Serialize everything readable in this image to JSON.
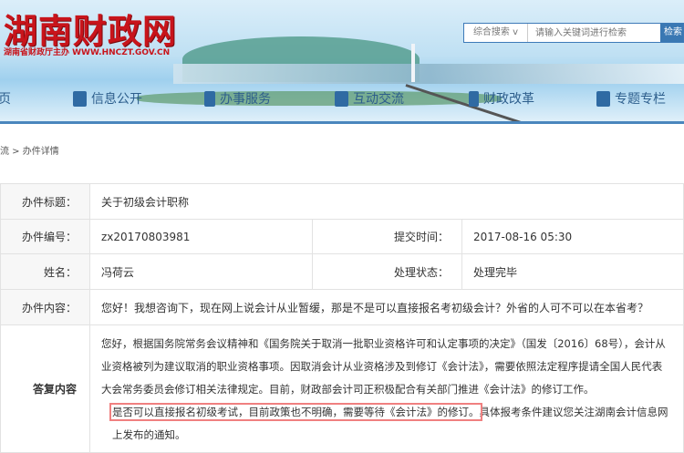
{
  "site": {
    "logo": "湖南财政网",
    "subtitle": "湖南省财政厅主办 WWW.HNCZT.GOV.CN"
  },
  "search": {
    "scope": "综合搜索 v",
    "placeholder": "请输入关键词进行检索",
    "button": "检索"
  },
  "nav": [
    {
      "label": "页"
    },
    {
      "label": "信息公开"
    },
    {
      "label": "办事服务"
    },
    {
      "label": "互动交流"
    },
    {
      "label": "财政改革"
    },
    {
      "label": "专题专栏"
    }
  ],
  "breadcrumb": "流 > 办件详情",
  "detail": {
    "title_label": "办件标题：",
    "title": "关于初级会计职称",
    "id_label": "办件编号：",
    "id": "zx20170803981",
    "time_label": "提交时间：",
    "time": "2017-08-16 05:30",
    "name_label": "姓名：",
    "name": "冯荷云",
    "status_label": "处理状态：",
    "status": "处理完毕",
    "content_label": "办件内容：",
    "content": "您好！我想咨询下，现在网上说会计从业暂缓，那是不是可以直接报名考初级会计？外省的人可不可以在本省考？",
    "reply_label": "答复内容",
    "reply_p1": "您好，根据国务院常务会议精神和《国务院关于取消一批职业资格许可和认定事项的决定》（国发〔2016〕68号），会计从业资格被列为建议取消的职业资格事项。因取消会计从业资格涉及到修订《会计法》，需要依照法定程序提请全国人民代表大会常务委员会修订相关法律规定。目前，财政部会计司正积极配合有关部门推进《会计法》的修订工作。",
    "reply_highlight": "是否可以直接报名初级考试，目前政策也不明确，需要等待《会计法》的修订。",
    "reply_rest": "具体报考条件建议您关注湖南会计信息网上发布的通知。"
  }
}
